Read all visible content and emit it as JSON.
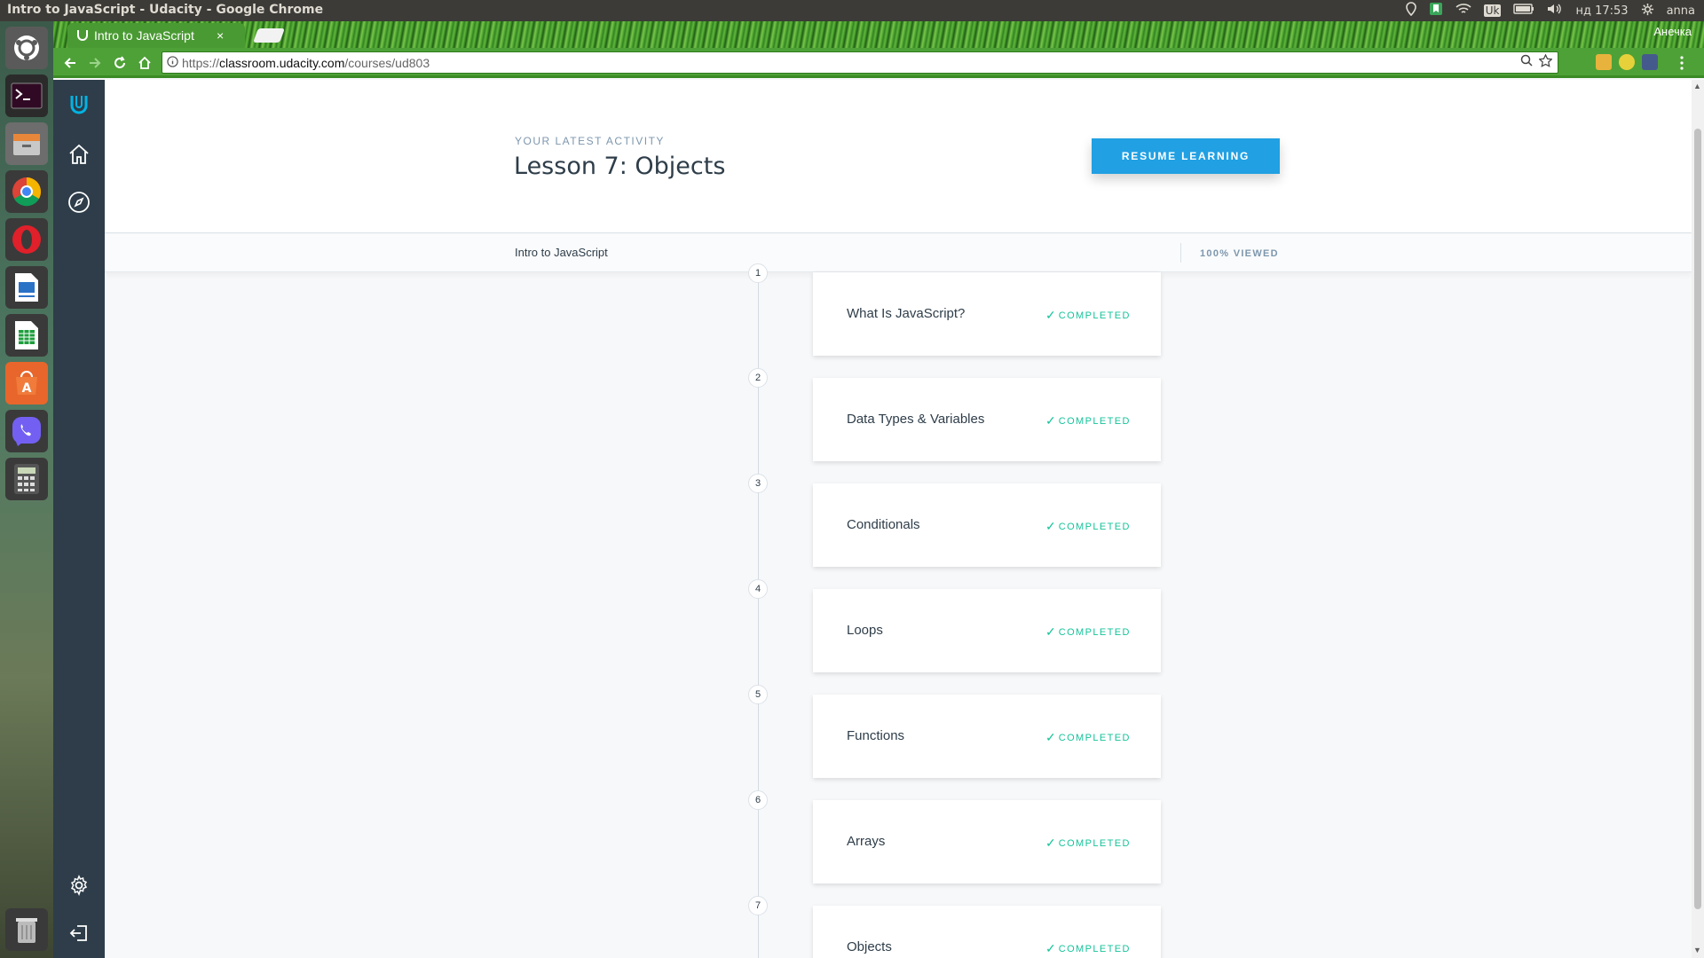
{
  "window": {
    "title": "Intro to JavaScript - Udacity - Google Chrome"
  },
  "panel": {
    "keyboard_layout": "Uk",
    "datetime": "нд 17:53",
    "user": "anna",
    "icons": [
      "location-icon",
      "bookmark-app-icon",
      "wifi-icon",
      "battery-icon",
      "volume-icon",
      "gear-icon"
    ]
  },
  "launcher": {
    "items": [
      "ubuntu-dash-icon",
      "terminal-icon",
      "files-icon",
      "chrome-icon",
      "opera-icon",
      "writer-icon",
      "calc-icon",
      "software-center-icon",
      "viber-icon",
      "calculator-icon",
      "trash-icon"
    ]
  },
  "browser": {
    "tab_title": "Intro to JavaScript",
    "tab_close": "×",
    "profile_name": "Анечка",
    "url_scheme": "https://",
    "url_host": "classroom.udacity.com",
    "url_path": "/courses/ud803"
  },
  "header": {
    "activity_label": "YOUR LATEST ACTIVITY",
    "lesson_title": "Lesson 7: Objects",
    "resume_button": "RESUME LEARNING"
  },
  "subbar": {
    "course_name": "Intro to JavaScript",
    "viewed": "100% VIEWED"
  },
  "lessons": [
    {
      "num": "1",
      "name": "What Is JavaScript?",
      "status": "COMPLETED"
    },
    {
      "num": "2",
      "name": "Data Types & Variables",
      "status": "COMPLETED"
    },
    {
      "num": "3",
      "name": "Conditionals",
      "status": "COMPLETED"
    },
    {
      "num": "4",
      "name": "Loops",
      "status": "COMPLETED"
    },
    {
      "num": "5",
      "name": "Functions",
      "status": "COMPLETED"
    },
    {
      "num": "6",
      "name": "Arrays",
      "status": "COMPLETED"
    },
    {
      "num": "7",
      "name": "Objects",
      "status": "COMPLETED"
    }
  ],
  "colors": {
    "accent": "#21a0e3",
    "completed": "#15c39a",
    "nav_bg": "#2e3d49"
  }
}
